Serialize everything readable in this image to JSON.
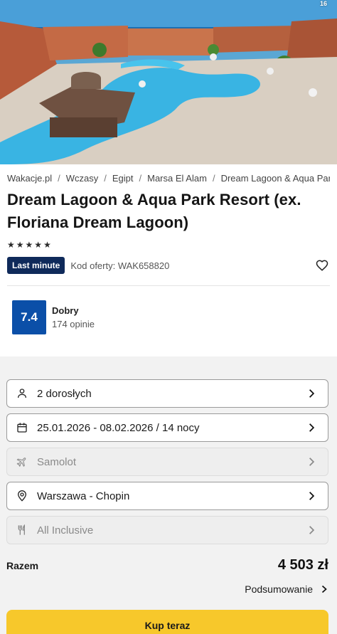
{
  "hero": {
    "photo_count": "16"
  },
  "breadcrumb": [
    "Wakacje.pl",
    "Wczasy",
    "Egipt",
    "Marsa El Alam",
    "Dream Lagoon & Aqua Park Resort"
  ],
  "hotel": {
    "title": "Dream Lagoon & Aqua Park Resort (ex. Floriana Dream Lagoon)",
    "stars": 5
  },
  "offer": {
    "badge": "Last minute",
    "code_label": "Kod oferty: WAK658820"
  },
  "rating": {
    "score": "7.4",
    "label": "Dobry",
    "count": "174 opinie"
  },
  "options": {
    "travelers": "2 dorosłych",
    "dates": "25.01.2026 - 08.02.2026 / 14 nocy",
    "transport": "Samolot",
    "departure": "Warszawa - Chopin",
    "board": "All Inclusive"
  },
  "summary": {
    "total_label": "Razem",
    "total_price": "4 503 zł",
    "summary_link": "Podsumowanie"
  },
  "cta": {
    "buy_label": "Kup teraz"
  },
  "colors": {
    "badge_bg": "#0f2a5a",
    "score_bg": "#0b4fa8",
    "cta_bg": "#f7c82b"
  }
}
